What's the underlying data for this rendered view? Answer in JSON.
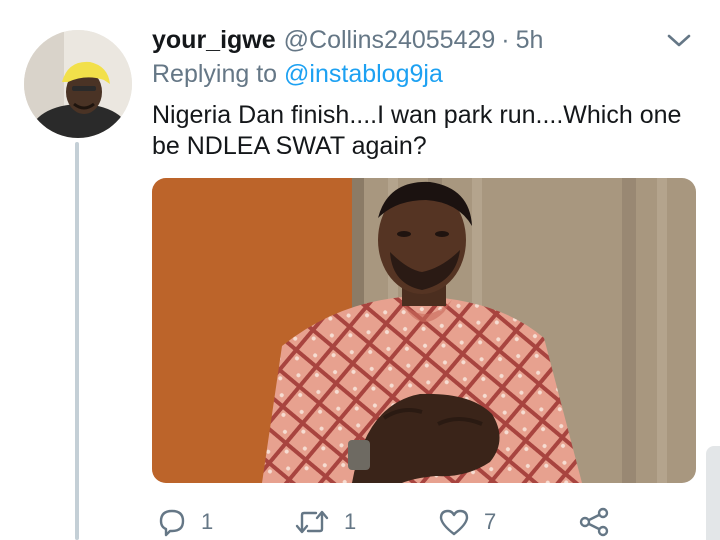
{
  "tweet": {
    "display_name": "your_igwe",
    "handle": "@Collins24055429",
    "separator": "·",
    "time": "5h",
    "replying_label": "Replying to",
    "replying_to": "@instablog9ja",
    "text": "Nigeria Dan finish....I wan park run....Which one be NDLEA SWAT again?"
  },
  "actions": {
    "reply_count": "1",
    "retweet_count": "1",
    "like_count": "7"
  },
  "icons": {
    "menu": "chevron-down-icon",
    "reply": "reply-icon",
    "retweet": "retweet-icon",
    "like": "heart-icon",
    "share": "share-icon"
  },
  "colors": {
    "text": "#14171a",
    "secondary": "#657786",
    "link": "#1da1f2",
    "thread_line": "#c4cfd6"
  }
}
